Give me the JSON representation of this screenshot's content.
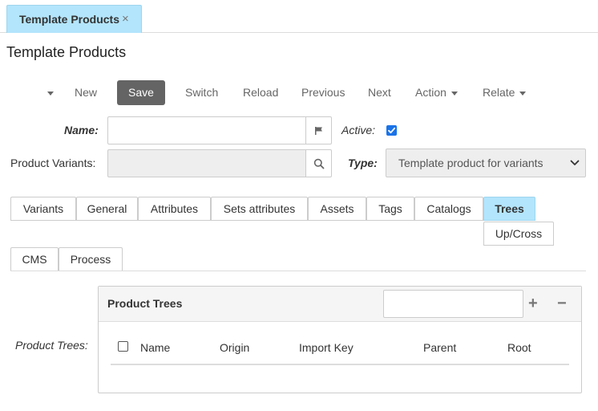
{
  "top_tab": {
    "label": "Template Products",
    "close": "×"
  },
  "page_title": "Template Products",
  "toolbar": {
    "new": "New",
    "save": "Save",
    "switch": "Switch",
    "reload": "Reload",
    "previous": "Previous",
    "next": "Next",
    "action": "Action",
    "relate": "Relate"
  },
  "form": {
    "name_label": "Name:",
    "name_value": "",
    "active_label": "Active:",
    "active_checked": true,
    "variants_label": "Product Variants:",
    "variants_value": "",
    "type_label": "Type:",
    "type_value": "Template product for variants"
  },
  "tabs": [
    "Variants",
    "General",
    "Attributes",
    "Sets attributes",
    "Assets",
    "Tags",
    "Catalogs",
    "Trees",
    "Up/Cross",
    "CMS",
    "Process"
  ],
  "active_tab": "Trees",
  "trees_panel": {
    "side_label": "Product Trees:",
    "title": "Product Trees",
    "search_value": "",
    "add_symbol": "+",
    "remove_symbol": "−",
    "columns": [
      "Name",
      "Origin",
      "Import Key",
      "Parent",
      "Root"
    ]
  },
  "colors": {
    "accent_tab": "#b3e5fc",
    "save_button": "#646464",
    "checkbox": "#1a73e8"
  },
  "icons": [
    "close-icon",
    "caret-down-icon",
    "flag-icon",
    "search-icon",
    "check-icon",
    "chevron-down-icon",
    "plus-icon",
    "minus-icon"
  ]
}
